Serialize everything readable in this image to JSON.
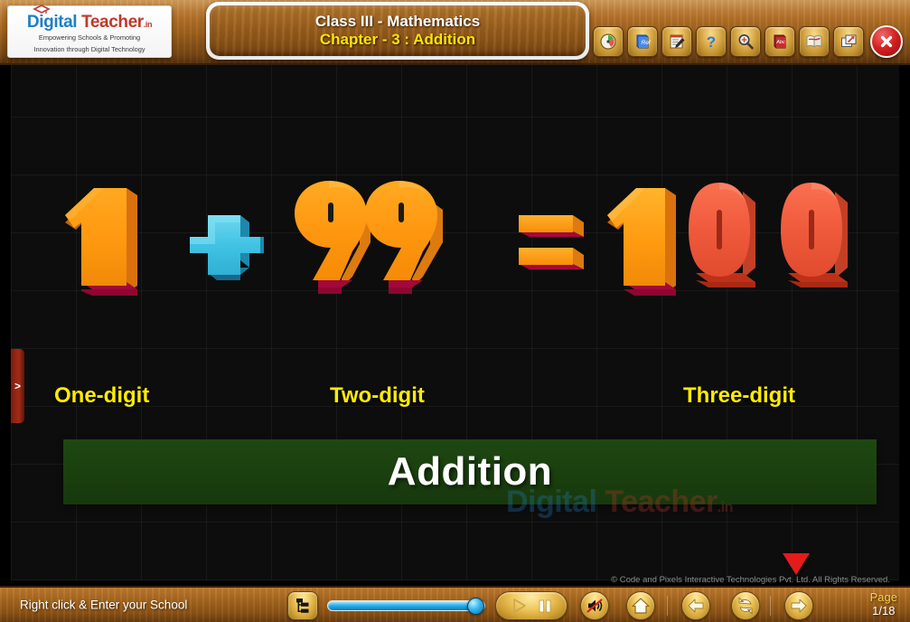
{
  "header": {
    "logo": {
      "brand_primary": "Digital",
      "brand_secondary": "Teacher",
      "brand_tld": ".in",
      "tagline_line1": "Empowering Schools & Promoting",
      "tagline_line2": "Innovation through Digital Technology"
    },
    "title": {
      "line1": "Class III - Mathematics",
      "line2": "Chapter - 3 : Addition"
    },
    "tools": [
      {
        "name": "dashboard-icon",
        "tooltip": "Dashboard"
      },
      {
        "name": "reference-book-icon",
        "tooltip": "Reference"
      },
      {
        "name": "notes-icon",
        "tooltip": "Notes"
      },
      {
        "name": "help-icon",
        "tooltip": "Help"
      },
      {
        "name": "zoom-icon",
        "tooltip": "Zoom"
      },
      {
        "name": "dictionary-icon",
        "tooltip": "Dictionary"
      },
      {
        "name": "glossary-icon",
        "tooltip": "Glossary"
      },
      {
        "name": "window-icon",
        "tooltip": "Window"
      }
    ],
    "close_label": "Close"
  },
  "stage": {
    "side_tab_label": ">",
    "equation": {
      "terms": [
        {
          "text": "1",
          "role": "one-digit-number"
        },
        {
          "text": "+",
          "role": "plus-sign"
        },
        {
          "text": "99",
          "role": "two-digit-number"
        },
        {
          "text": "=",
          "role": "equals-sign"
        },
        {
          "text": "100",
          "role": "three-digit-number"
        }
      ]
    },
    "labels": [
      {
        "text": "One-digit"
      },
      {
        "text": "Two-digit"
      },
      {
        "text": "Three-digit"
      }
    ],
    "banner_text": "Addition",
    "watermark": {
      "part1": "Digital",
      "part2": "Teacher",
      "part3": ".in"
    },
    "copyright": "© Code and Pixels Interactive Technologies  Pvt. Ltd. All Rights Reserved."
  },
  "footer": {
    "school_prompt": "Right click & Enter your School",
    "menu_icon": "menu-tree-icon",
    "seek_value": 100,
    "controls": [
      {
        "name": "play-button",
        "label": "Play"
      },
      {
        "name": "pause-button",
        "label": "Pause"
      },
      {
        "name": "sound-mute-button",
        "label": "Sound Off"
      },
      {
        "name": "home-button",
        "label": "Home"
      },
      {
        "name": "previous-button",
        "label": "Previous"
      },
      {
        "name": "reload-button",
        "label": "Reload"
      },
      {
        "name": "next-button",
        "label": "Next"
      }
    ],
    "page_label": "Page",
    "page_value": "1/18"
  },
  "colors": {
    "wood": "#a8681f",
    "accent_yellow": "#ffec00",
    "number_orange": "#ff9a18",
    "number_red": "#f05a3c",
    "banner_green": "#1e4712",
    "close_red": "#d42020"
  }
}
